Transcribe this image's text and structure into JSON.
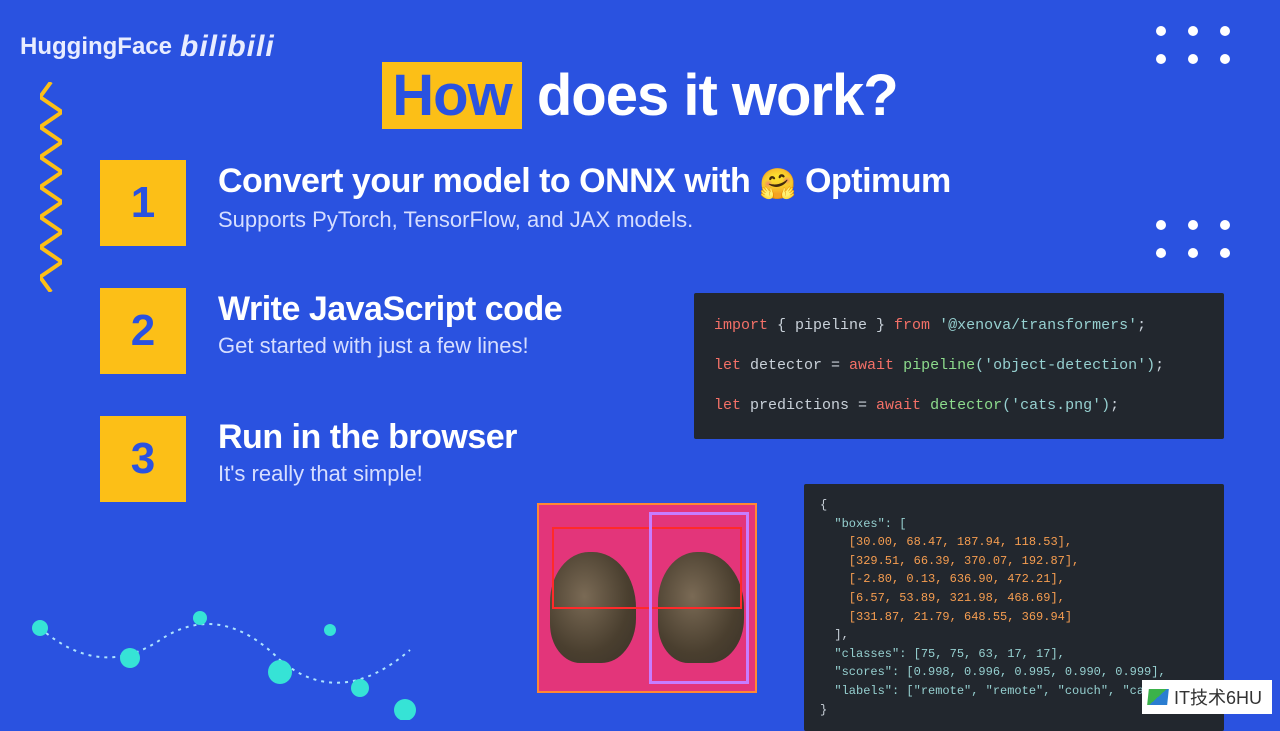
{
  "logos": {
    "hf": "HuggingFace",
    "bilibili": "bilibili"
  },
  "title": {
    "highlight": "How",
    "rest": " does it work?"
  },
  "steps": [
    {
      "num": "1",
      "title_pre": "Convert your model to ONNX with ",
      "emoji": "🤗",
      "title_post": " Optimum",
      "sub": "Supports PyTorch, TensorFlow, and JAX models."
    },
    {
      "num": "2",
      "title_pre": "Write JavaScript code",
      "emoji": "",
      "title_post": "",
      "sub": "Get started with just a few lines!"
    },
    {
      "num": "3",
      "title_pre": "Run in the browser",
      "emoji": "",
      "title_post": "",
      "sub": "It's really that simple!"
    }
  ],
  "code_a": {
    "line1_import": "import",
    "line1_mid": " { pipeline } ",
    "line1_from": "from",
    "line1_str": " '@xenova/transformers'",
    "line1_end": ";",
    "line2_let": "let",
    "line2_var": " detector = ",
    "line2_await": "await",
    "line2_fn": " pipeline",
    "line2_arg": "('object-detection')",
    "line2_end": ";",
    "line3_let": "let",
    "line3_var": " predictions = ",
    "line3_await": "await",
    "line3_fn": " detector",
    "line3_arg": "('cats.png')",
    "line3_end": ";"
  },
  "code_b": {
    "open": "{",
    "boxes_key": "  \"boxes\": [",
    "box0": "    [30.00, 68.47, 187.94, 118.53],",
    "box1": "    [329.51, 66.39, 370.07, 192.87],",
    "box2": "    [-2.80, 0.13, 636.90, 472.21],",
    "box3": "    [6.57, 53.89, 321.98, 468.69],",
    "box4": "    [331.87, 21.79, 648.55, 369.94]",
    "boxes_close": "  ],",
    "classes": "  \"classes\": [75, 75, 63, 17, 17],",
    "scores": "  \"scores\": [0.998, 0.996, 0.995, 0.990, 0.999],",
    "labels": "  \"labels\": [\"remote\", \"remote\", \"couch\", \"cat\", \"cat\"]",
    "close": "}"
  },
  "watermark": "IT技术6HU"
}
